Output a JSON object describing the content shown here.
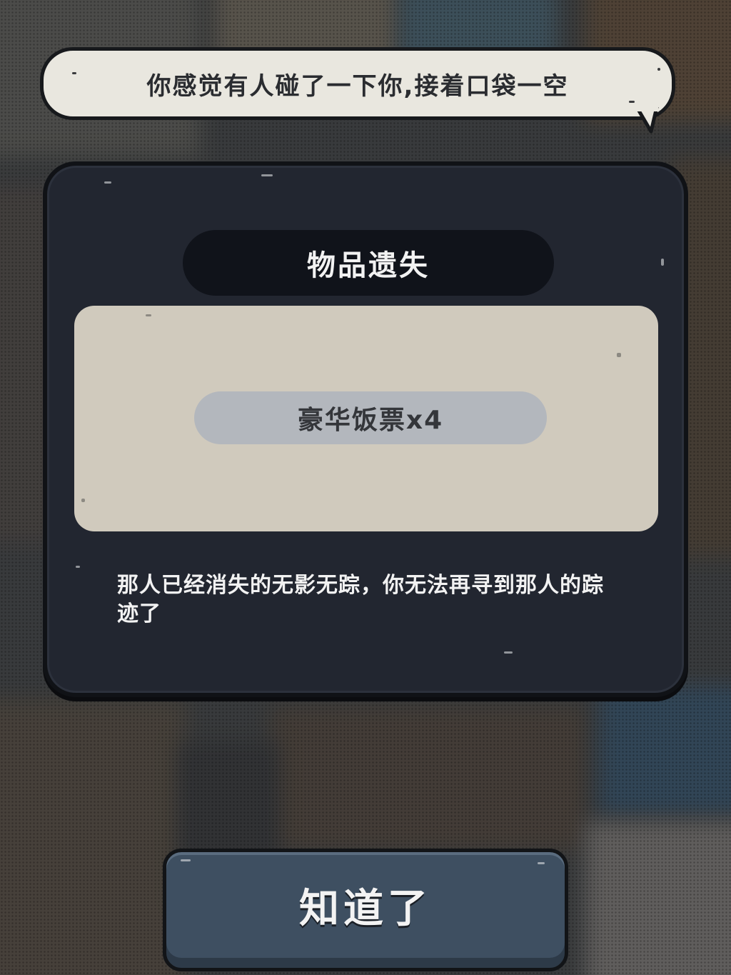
{
  "speech_bubble": {
    "text": "你感觉有人碰了一下你,接着口袋一空"
  },
  "dialog": {
    "title": "物品遗失",
    "item": {
      "label": "豪华饭票x4"
    },
    "message": "那人已经消失的无影无踪，你无法再寻到那人的踪迹了"
  },
  "confirm_button": {
    "label": "知道了"
  },
  "colors": {
    "panel": "#222630",
    "panel_border": "#101216",
    "title_pill": "#10131a",
    "item_box": "#d0cabd",
    "item_pill": "#b3b7bd",
    "bubble": "#e9e7df",
    "button": "#3e4f61",
    "text_light": "#f2f2f2",
    "text_dark": "#34363a"
  }
}
